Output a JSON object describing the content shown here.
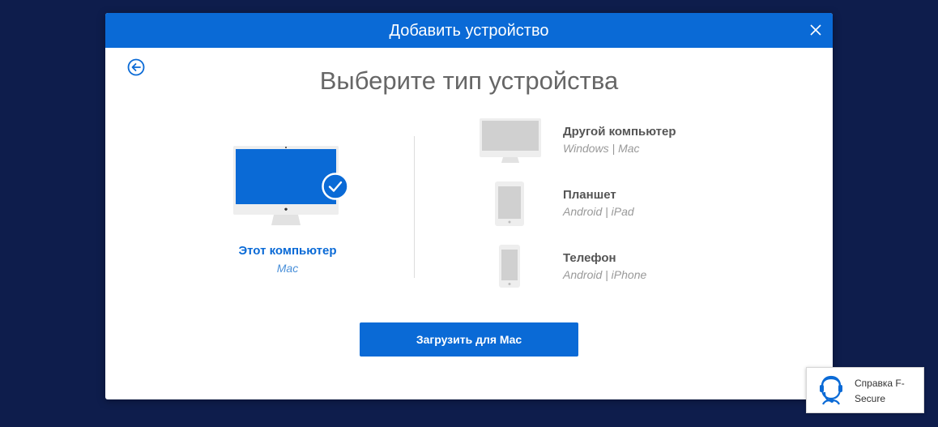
{
  "dialog": {
    "title": "Добавить устройство",
    "page_title": "Выберите тип устройства"
  },
  "selected_device": {
    "label": "Этот компьютер",
    "sub": "Mac"
  },
  "options": [
    {
      "title": "Другой компьютер",
      "sub": "Windows | Mac",
      "icon": "monitor-icon"
    },
    {
      "title": "Планшет",
      "sub": "Android | iPad",
      "icon": "tablet-icon"
    },
    {
      "title": "Телефон",
      "sub": "Android | iPhone",
      "icon": "phone-icon"
    }
  ],
  "download_button": "Загрузить для Mac",
  "help": {
    "label": "Справка F-Secure"
  },
  "colors": {
    "accent": "#0a6ad6",
    "backdrop": "#0e1d4c"
  }
}
